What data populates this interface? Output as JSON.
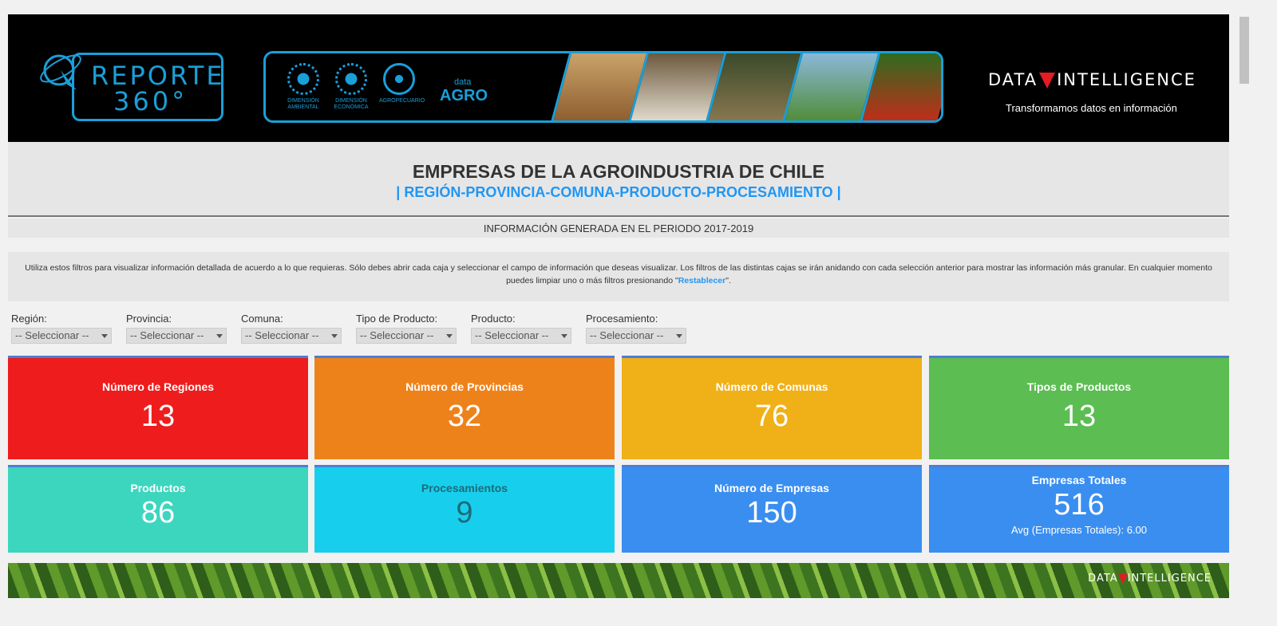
{
  "banner": {
    "logo_line1": "REPORTE",
    "logo_line2": "360°",
    "seals": [
      {
        "label": "DIMENSIÓN AMBIENTAL"
      },
      {
        "label": "DIMENSIÓN ECONÓMICA"
      },
      {
        "label": "AGROPECUARIO"
      }
    ],
    "data_agro_small": "data",
    "data_agro_big": "AGRO",
    "di_left": "DATA",
    "di_right": "INTELLIGENCE",
    "di_tagline": "Transformamos datos en información"
  },
  "title": {
    "main": "EMPRESAS DE LA AGROINDUSTRIA DE CHILE",
    "sub": "| REGIÓN-PROVINCIA-COMUNA-PRODUCTO-PROCESAMIENTO |"
  },
  "period": "INFORMACIÓN GENERADA EN EL PERIODO 2017-2019",
  "intro": {
    "text": "Utiliza estos filtros para visualizar información detallada de acuerdo a lo que requieras. Sólo debes abrir cada caja y seleccionar el campo de información que deseas visualizar. Los filtros de las distintas cajas se irán anidando con cada selección anterior para mostrar las información más granular. En cualquier momento puedes limpiar uno o más filtros presionando \"",
    "link": "Restablecer",
    "end": "\"."
  },
  "filters": [
    {
      "label": "Región:",
      "value": "-- Seleccionar --"
    },
    {
      "label": "Provincia:",
      "value": "-- Seleccionar --"
    },
    {
      "label": "Comuna:",
      "value": "-- Seleccionar --"
    },
    {
      "label": "Tipo de Producto:",
      "value": "-- Seleccionar --"
    },
    {
      "label": "Producto:",
      "value": "-- Seleccionar --"
    },
    {
      "label": "Procesamiento:",
      "value": "-- Seleccionar --"
    }
  ],
  "kpis": [
    {
      "label": "Número de Regiones",
      "value": "13",
      "color": "#ee1c1c"
    },
    {
      "label": "Número de Provincias",
      "value": "32",
      "color": "#ee821a"
    },
    {
      "label": "Número de Comunas",
      "value": "76",
      "color": "#f0b017"
    },
    {
      "label": "Tipos de Productos",
      "value": "13",
      "color": "#5bbd52"
    },
    {
      "label": "Productos",
      "value": "86",
      "color": "#3cd6bf"
    },
    {
      "label": "Procesamientos",
      "value": "9",
      "color": "#17cfed"
    },
    {
      "label": "Número de Empresas",
      "value": "150",
      "color": "#3a8ef0"
    },
    {
      "label": "Empresas Totales",
      "value": "516",
      "sub": "Avg (Empresas Totales): 6.00",
      "color": "#3a8ef0"
    }
  ],
  "footer": {
    "di_left": "DATA",
    "di_right": "INTELLIGENCE"
  }
}
